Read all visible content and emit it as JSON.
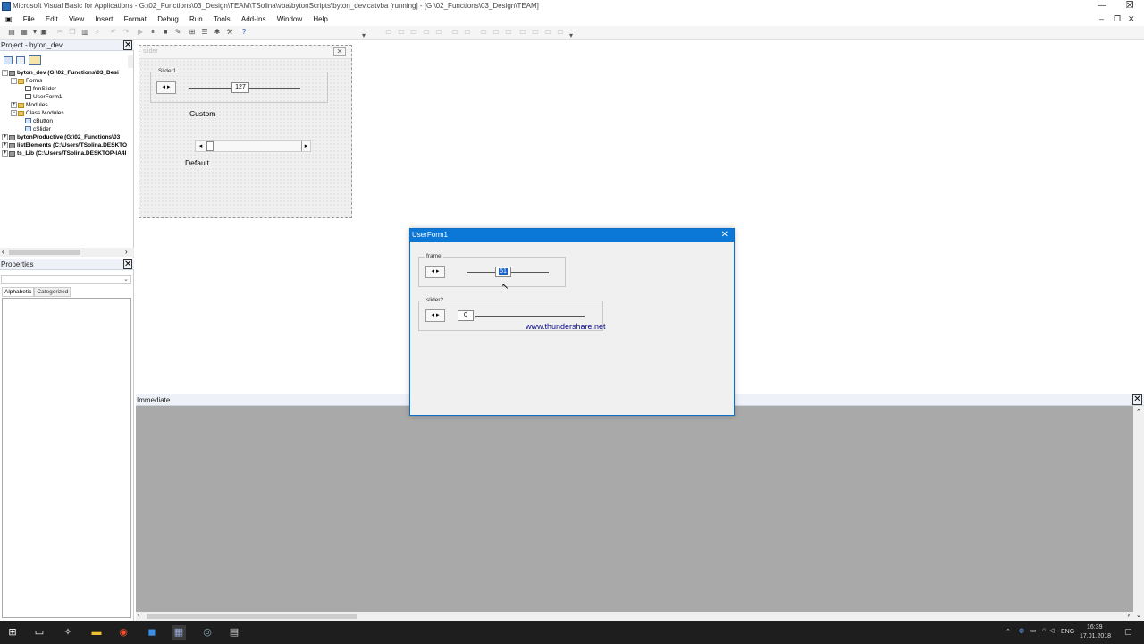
{
  "window": {
    "title": "Microsoft Visual Basic for Applications - G:\\02_Functions\\03_Design\\TEAM\\TSolina\\vba\\bytonScripts\\byton_dev.catvba [running] - [G:\\02_Functions\\03_Design\\TEAM]",
    "minimize": "—",
    "restore": "❐",
    "close": "✕"
  },
  "menu": {
    "items": [
      "File",
      "Edit",
      "View",
      "Insert",
      "Format",
      "Debug",
      "Run",
      "Tools",
      "Add-Ins",
      "Window",
      "Help"
    ],
    "right_controls": [
      "–",
      "❐",
      "✕"
    ]
  },
  "project_explorer": {
    "title": "Project - byton_dev",
    "close": "✕",
    "tree": [
      {
        "label": "byton_dev (G:\\02_Functions\\03_Desi",
        "bold": true,
        "level": 0,
        "toggle": "−",
        "icon": "proj"
      },
      {
        "label": "Forms",
        "bold": false,
        "level": 1,
        "toggle": "−",
        "icon": "folder"
      },
      {
        "label": "frmSlider",
        "bold": false,
        "level": 2,
        "toggle": "",
        "icon": "form"
      },
      {
        "label": "UserForm1",
        "bold": false,
        "level": 2,
        "toggle": "",
        "icon": "form"
      },
      {
        "label": "Modules",
        "bold": false,
        "level": 1,
        "toggle": "+",
        "icon": "folder"
      },
      {
        "label": "Class Modules",
        "bold": false,
        "level": 1,
        "toggle": "−",
        "icon": "folder"
      },
      {
        "label": "cButton",
        "bold": false,
        "level": 2,
        "toggle": "",
        "icon": "mod"
      },
      {
        "label": "cSlider",
        "bold": false,
        "level": 2,
        "toggle": "",
        "icon": "mod"
      },
      {
        "label": "bytonProductive (G:\\02_Functions\\03",
        "bold": true,
        "level": 0,
        "toggle": "+",
        "icon": "proj"
      },
      {
        "label": "listElements (C:\\Users\\TSolina.DESKTO",
        "bold": true,
        "level": 0,
        "toggle": "+",
        "icon": "proj"
      },
      {
        "label": "ts_Lib (C:\\Users\\TSolina.DESKTOP-IA4I",
        "bold": true,
        "level": 0,
        "toggle": "+",
        "icon": "proj"
      }
    ]
  },
  "properties": {
    "title": "Properties",
    "close": "✕",
    "tabs": [
      "Alphabetic",
      "Categorized"
    ]
  },
  "designer": {
    "title": "slider",
    "close": "✕",
    "frame_caption": "Slider1",
    "slider_value": "127",
    "custom_label": "Custom",
    "default_label": "Default"
  },
  "immediate": {
    "title": "Immediate",
    "close": "✕"
  },
  "userform": {
    "title": "UserForm1",
    "close": "✕",
    "frame1_caption": "frame",
    "frame1_value": "51",
    "frame2_caption": "slider2",
    "frame2_value": "0",
    "watermark": "www.thundershare.net"
  },
  "taskbar": {
    "clock_time": "16:39",
    "clock_date": "17.01.2018",
    "lang": "ENG"
  }
}
